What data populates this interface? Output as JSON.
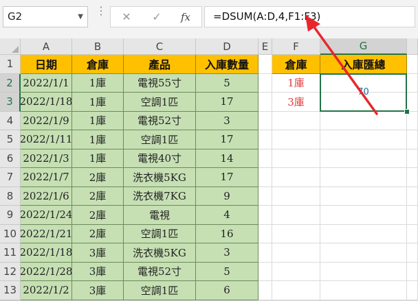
{
  "formula_bar": {
    "name_box": "G2",
    "dropdown_icon": "chevron-down-icon",
    "cancel_icon": "✕",
    "enter_icon": "✓",
    "fx_label": "fx",
    "formula": "=DSUM(A:D,4,F1:F3)"
  },
  "columns": [
    "A",
    "B",
    "C",
    "D",
    "E",
    "F",
    "G"
  ],
  "rows": [
    "1",
    "2",
    "3",
    "4",
    "5",
    "6",
    "7",
    "8",
    "9",
    "10",
    "11",
    "12",
    "13"
  ],
  "table": {
    "headers": [
      "日期",
      "倉庫",
      "產品",
      "入庫數量"
    ],
    "rows": [
      [
        "2022/1/1",
        "1庫",
        "電視55寸",
        "5"
      ],
      [
        "2022/1/18",
        "1庫",
        "空調1匹",
        "17"
      ],
      [
        "2022/1/9",
        "1庫",
        "電視52寸",
        "3"
      ],
      [
        "2022/1/11",
        "1庫",
        "空調1匹",
        "17"
      ],
      [
        "2022/1/3",
        "1庫",
        "電視40寸",
        "14"
      ],
      [
        "2022/1/7",
        "2庫",
        "洗衣機5KG",
        "17"
      ],
      [
        "2022/1/6",
        "2庫",
        "洗衣機7KG",
        "9"
      ],
      [
        "2022/1/24",
        "2庫",
        "電視",
        "4"
      ],
      [
        "2022/1/21",
        "2庫",
        "空調1匹",
        "16"
      ],
      [
        "2022/1/18",
        "3庫",
        "洗衣機5KG",
        "3"
      ],
      [
        "2022/1/28",
        "3庫",
        "電視52寸",
        "5"
      ],
      [
        "2022/1/2",
        "3庫",
        "空調1匹",
        "6"
      ]
    ]
  },
  "criteria": {
    "header": "倉庫",
    "values": [
      "1庫",
      "3庫"
    ]
  },
  "summary": {
    "header": "入庫匯總",
    "value": "70"
  },
  "colors": {
    "header_fill": "#ffc000",
    "data_fill": "#c6e0b4",
    "criteria_text": "#e23b3b",
    "result_text": "#1d6fa8",
    "selection": "#217346",
    "arrow": "#e8262c"
  }
}
